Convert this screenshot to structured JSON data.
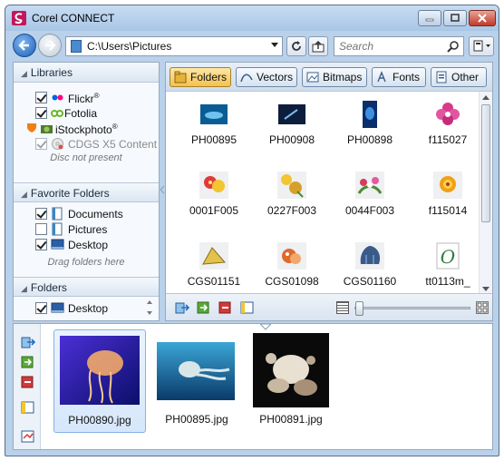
{
  "window": {
    "title": "Corel CONNECT"
  },
  "address": {
    "path": "C:\\Users\\Pictures",
    "search_placeholder": "Search"
  },
  "libraries": {
    "header": "Libraries",
    "items": [
      {
        "label": "Flickr",
        "sup": "®",
        "checked": true
      },
      {
        "label": "Fotolia",
        "sup": "",
        "checked": true
      },
      {
        "label": "iStockphoto",
        "sup": "®",
        "checked": true
      },
      {
        "label": "CDGS X5 Content",
        "sup": "",
        "checked": true
      }
    ],
    "note": "Disc not present"
  },
  "favorites": {
    "header": "Favorite Folders",
    "items": [
      {
        "label": "Documents",
        "checked": true
      },
      {
        "label": "Pictures",
        "checked": false
      },
      {
        "label": "Desktop",
        "checked": true
      }
    ],
    "hint": "Drag folders here"
  },
  "folders": {
    "header": "Folders",
    "items": [
      {
        "label": "Desktop",
        "checked": true
      }
    ]
  },
  "filters": [
    {
      "label": "Folders",
      "active": true
    },
    {
      "label": "Vectors",
      "active": false
    },
    {
      "label": "Bitmaps",
      "active": false
    },
    {
      "label": "Fonts",
      "active": false
    },
    {
      "label": "Other",
      "active": false
    }
  ],
  "content_items": [
    "PH00895",
    "PH00908",
    "PH00898",
    "f115027",
    "0001F005",
    "0227F003",
    "0044F003",
    "f115014",
    "CGS01151",
    "CGS01098",
    "CGS01160",
    "tt0113m_"
  ],
  "tray": {
    "items": [
      {
        "label": "PH00890.jpg",
        "selected": true
      },
      {
        "label": "PH00895.jpg",
        "selected": false
      },
      {
        "label": "PH00891.jpg",
        "selected": false
      }
    ]
  },
  "colors": {
    "accent": "#f5c24c",
    "window_frame": "#b9d1ea",
    "selection": "#d6e7fb"
  }
}
